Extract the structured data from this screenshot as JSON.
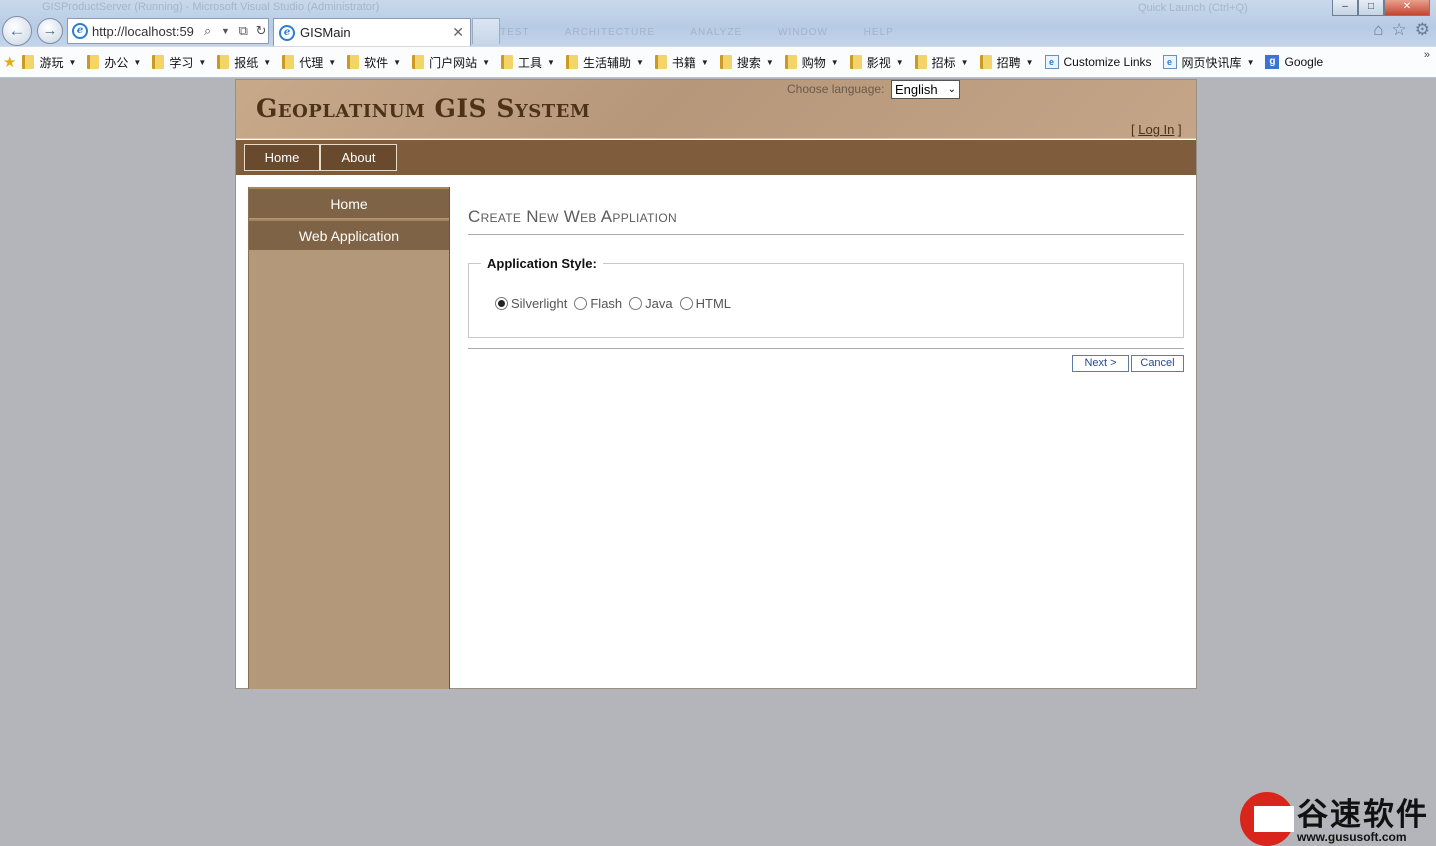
{
  "browser": {
    "window_title_faded": "GISProductServer (Running) - Microsoft Visual Studio (Administrator)",
    "menu_faded": [
      "TEST",
      "ARCHITECTURE",
      "ANALYZE",
      "WINDOW",
      "HELP"
    ],
    "quick_launch_faded": "Quick Launch (Ctrl+Q)",
    "address": "http://localhost:59",
    "tab_title": "GISMain",
    "win_buttons": [
      "–",
      "□",
      "✕"
    ],
    "toolbar_icons": [
      "home-icon",
      "star-icon",
      "gear-icon"
    ],
    "favorites": [
      {
        "label": "游玩",
        "dropdown": true
      },
      {
        "label": "办公",
        "dropdown": true
      },
      {
        "label": "学习",
        "dropdown": true
      },
      {
        "label": "报纸",
        "dropdown": true
      },
      {
        "label": "代理",
        "dropdown": true
      },
      {
        "label": "软件",
        "dropdown": true
      },
      {
        "label": "门户网站",
        "dropdown": true
      },
      {
        "label": "工具",
        "dropdown": true
      },
      {
        "label": "生活辅助",
        "dropdown": true
      },
      {
        "label": "书籍",
        "dropdown": true
      },
      {
        "label": "搜索",
        "dropdown": true
      },
      {
        "label": "购物",
        "dropdown": true
      },
      {
        "label": "影视",
        "dropdown": true
      },
      {
        "label": "招标",
        "dropdown": true
      },
      {
        "label": "招聘",
        "dropdown": true
      }
    ],
    "fav_links": [
      {
        "label": "Customize Links",
        "icon": "ie-page-icon"
      },
      {
        "label": "网页快讯库",
        "icon": "ie-page-icon",
        "dropdown": true
      },
      {
        "label": "Google",
        "icon": "google-icon"
      }
    ],
    "more_glyph": "»"
  },
  "page": {
    "app_title": "Geoplatinum GIS System",
    "language_label": "Choose language:",
    "language_value": "English",
    "login_open": "[ ",
    "login_link": "Log In",
    "login_close": " ]",
    "menu": [
      "Home",
      "About"
    ],
    "sidebar": [
      "Home",
      "Web Application"
    ],
    "content_title": "Create New Web Appliation",
    "fieldset_legend": "Application Style:",
    "options": [
      {
        "label": "Silverlight",
        "checked": true
      },
      {
        "label": "Flash",
        "checked": false
      },
      {
        "label": "Java",
        "checked": false
      },
      {
        "label": "HTML",
        "checked": false
      }
    ],
    "next_button": "Next >",
    "cancel_button": "Cancel"
  },
  "watermark": {
    "text": "谷速软件",
    "url": "www.gususoft.com"
  },
  "colors": {
    "header_bg": "#c0a082",
    "menubar_bg": "#7e5c3c",
    "sidebar_bg": "#b3997a",
    "page_bg": "#b3b5ba",
    "accent_button": "#1f4b8c"
  }
}
